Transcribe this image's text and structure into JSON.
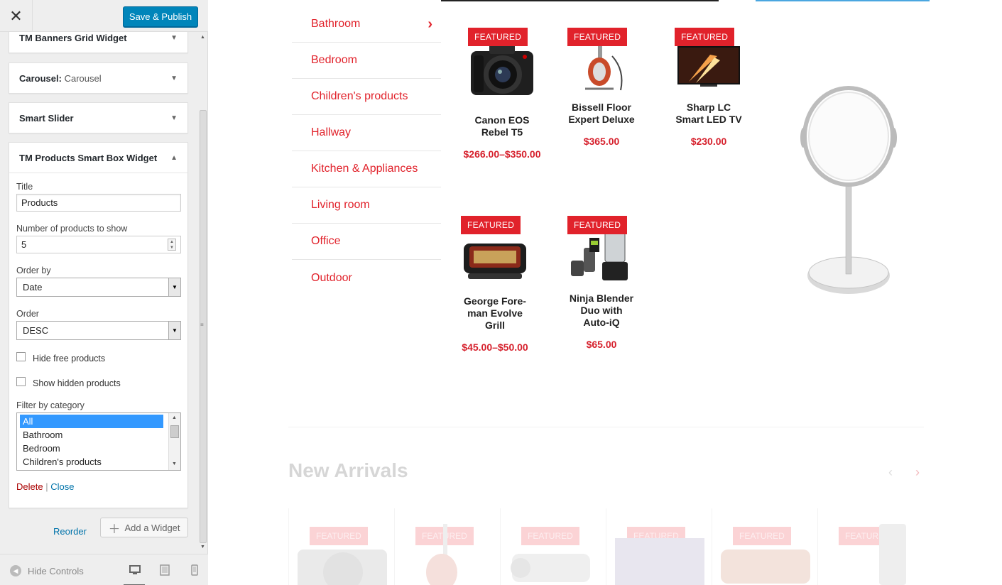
{
  "topbar": {
    "close_glyph": "✕",
    "publish_label": "Save & Publish"
  },
  "widgets": [
    {
      "title": "TM Banners Grid Widget",
      "subtitle": ""
    },
    {
      "title": "Carousel:",
      "subtitle": "Carousel"
    },
    {
      "title": "Smart Slider",
      "subtitle": ""
    },
    {
      "title": "TM Products Smart Box Widget",
      "subtitle": ""
    }
  ],
  "form": {
    "title_label": "Title",
    "title_value": "Products",
    "count_label": "Number of products to show",
    "count_value": "5",
    "orderby_label": "Order by",
    "orderby_value": "Date",
    "order_label": "Order",
    "order_value": "DESC",
    "hide_free_label": "Hide free products",
    "hide_free_checked": false,
    "show_hidden_label": "Show hidden products",
    "show_hidden_checked": false,
    "filter_label": "Filter by category",
    "filter_options": [
      "All",
      "Bathroom",
      "Bedroom",
      "Children's products"
    ],
    "filter_selected": "All",
    "delete_label": "Delete",
    "separator": "|",
    "close_label": "Close"
  },
  "actions": {
    "reorder_label": "Reorder",
    "add_widget_label": "Add a Widget"
  },
  "footer": {
    "hide_controls_label": "Hide Controls",
    "devices": [
      "desktop-icon",
      "tablet-icon",
      "mobile-icon"
    ],
    "active_device": "desktop-icon"
  },
  "preview": {
    "categories": [
      "Bathroom",
      "Bedroom",
      "Children's products",
      "Hallway",
      "Kitchen & Appliances",
      "Living room",
      "Office",
      "Outdoor"
    ],
    "active_category": "Bathroom",
    "badge_label": "FEATURED",
    "products": [
      {
        "name": "Canon EOS Rebel T5",
        "price": "$266.00–$350.00",
        "image": "camera-icon"
      },
      {
        "name": "Bissell Floor Expert Deluxe",
        "price": "$365.00",
        "image": "vacuum-icon"
      },
      {
        "name": "Sharp LC Smart LED TV",
        "price": "$230.00",
        "image": "tv-icon"
      },
      {
        "name": "George Fore-man Evolve Grill",
        "price": "$45.00–$50.00",
        "image": "grill-icon"
      },
      {
        "name": "Ninja Blender Duo with Auto-iQ",
        "price": "$65.00",
        "image": "blender-icon"
      }
    ],
    "section_title": "New Arrivals",
    "prev_glyph": "‹",
    "next_glyph": "›"
  },
  "colors": {
    "accent_red": "#e1222b",
    "wp_blue": "#0085ba",
    "link_blue": "#0073aa"
  }
}
